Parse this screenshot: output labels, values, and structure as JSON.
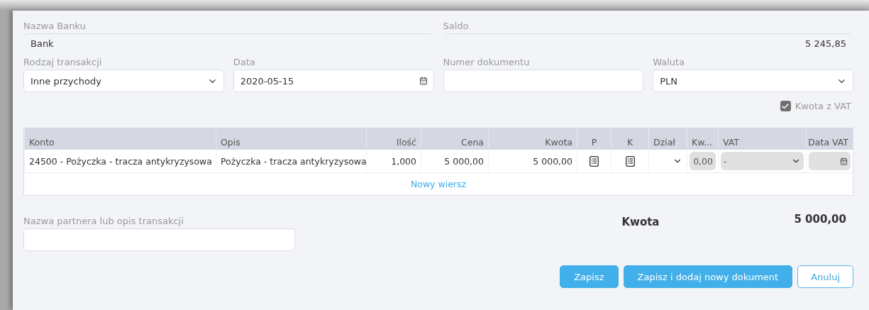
{
  "bank": {
    "label": "Nazwa Banku",
    "value": "Bank"
  },
  "balance": {
    "label": "Saldo",
    "value": "5 245,85"
  },
  "fields": [
    {
      "kind": "select",
      "label": "Rodzaj transakcji",
      "value": "Inne przychody"
    },
    {
      "kind": "date",
      "label": "Data",
      "value": "2020-05-15"
    },
    {
      "kind": "text",
      "label": "Numer dokumentu"
    },
    {
      "kind": "select",
      "label": "Waluta",
      "value": "PLN"
    }
  ],
  "vat_included": {
    "label": "Kwota z VAT",
    "checked": true
  },
  "table": {
    "columns": [
      {
        "label": "Konto"
      },
      {
        "label": "Opis"
      },
      {
        "label": "Ilość"
      },
      {
        "label": "Cena"
      },
      {
        "label": "Kwota"
      },
      {
        "label": "P"
      },
      {
        "label": "K"
      },
      {
        "label": "Dział"
      },
      {
        "label": "Kw..."
      },
      {
        "label": "VAT"
      },
      {
        "label": "Data VAT"
      }
    ],
    "rows": [
      {
        "cells": [
          {
            "kind": "select",
            "value": "24500 - Pożyczka - tracza antykryzysowa"
          },
          {
            "kind": "text",
            "value": "Pożyczka - tracza antykryzysowa"
          },
          {
            "kind": "number",
            "value": "1,000"
          },
          {
            "kind": "number",
            "value": "5 000,00"
          },
          {
            "kind": "number",
            "value": "5 000,00"
          },
          {
            "kind": "list-button"
          },
          {
            "kind": "list-button"
          },
          {
            "kind": "select-empty"
          },
          {
            "kind": "disabled-input",
            "value": "0,00"
          },
          {
            "kind": "disabled-select",
            "value": "-"
          },
          {
            "kind": "disabled-date"
          }
        ]
      }
    ],
    "new_row": "Nowy wiersz"
  },
  "partner": {
    "label": "Nazwa partnera lub opis transakcji"
  },
  "total": {
    "label": "Kwota",
    "value": "5 000,00"
  },
  "buttons": [
    {
      "label": "Zapisz",
      "kind": "primary"
    },
    {
      "label": "Zapisz i dodaj nowy dokument",
      "kind": "primary"
    },
    {
      "label": "Anuluj",
      "kind": "outline"
    }
  ]
}
